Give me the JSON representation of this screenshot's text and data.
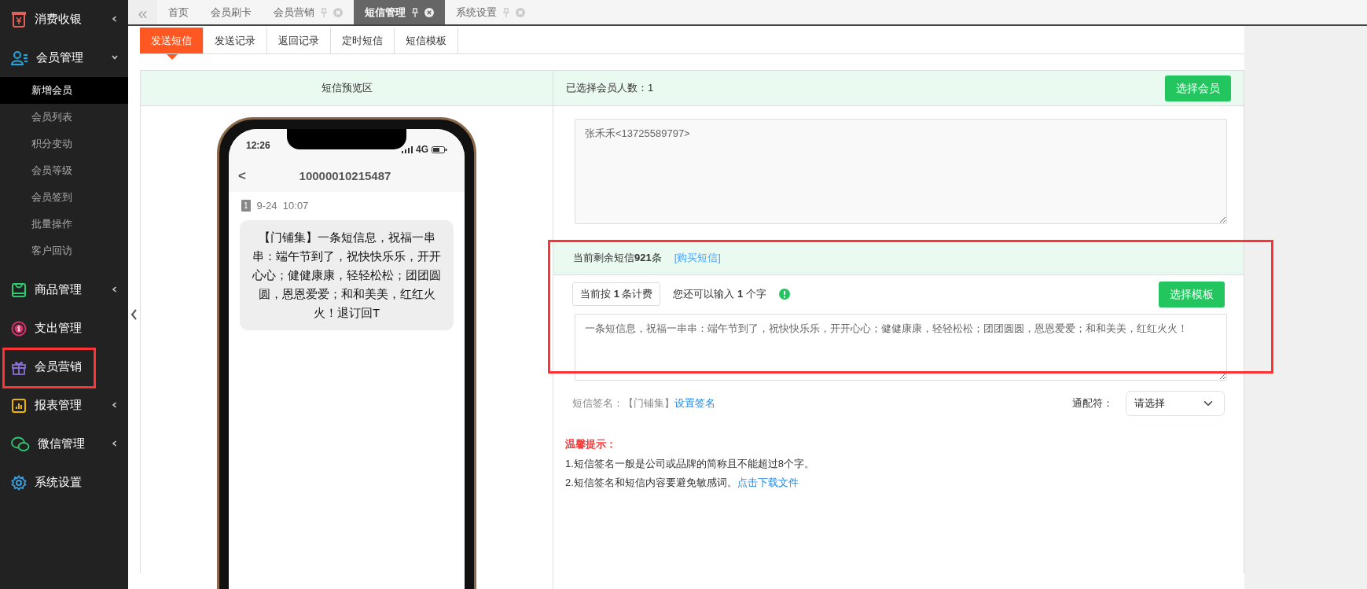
{
  "sidebar": {
    "items": [
      {
        "label": "消费收银",
        "expanded": false,
        "highlighted": false
      },
      {
        "label": "会员管理",
        "expanded": true,
        "highlighted": false,
        "children": [
          {
            "label": "新增会员",
            "selected": true
          },
          {
            "label": "会员列表",
            "selected": false
          },
          {
            "label": "积分变动",
            "selected": false
          },
          {
            "label": "会员等级",
            "selected": false
          },
          {
            "label": "会员签到",
            "selected": false
          },
          {
            "label": "批量操作",
            "selected": false
          },
          {
            "label": "客户回访",
            "selected": false
          }
        ]
      },
      {
        "label": "商品管理",
        "expanded": false,
        "highlighted": false
      },
      {
        "label": "支出管理",
        "highlighted": false
      },
      {
        "label": "会员营销",
        "highlighted": true
      },
      {
        "label": "报表管理",
        "expanded": false,
        "highlighted": false
      },
      {
        "label": "微信管理",
        "expanded": false,
        "highlighted": false
      },
      {
        "label": "系统设置",
        "highlighted": false
      }
    ]
  },
  "top_tabs": {
    "collapse_button": "«",
    "tabs": [
      {
        "label": "首页",
        "closable": false,
        "selected": false
      },
      {
        "label": "会员刷卡",
        "closable": false,
        "selected": false
      },
      {
        "label": "会员营销",
        "closable": true,
        "selected": false
      },
      {
        "label": "短信管理",
        "closable": true,
        "selected": true
      },
      {
        "label": "系统设置",
        "closable": true,
        "selected": false
      }
    ]
  },
  "sub_tabs": [
    {
      "label": "发送短信",
      "selected": true
    },
    {
      "label": "发送记录",
      "selected": false
    },
    {
      "label": "返回记录",
      "selected": false
    },
    {
      "label": "定时短信",
      "selected": false
    },
    {
      "label": "短信模板",
      "selected": false
    }
  ],
  "preview": {
    "title": "短信预览区",
    "phone": {
      "time": "12:26",
      "network": "4G",
      "back": "<",
      "sender": "10000010215487",
      "sim": "1",
      "date": "9-24  10:07",
      "message": "【门铺集】一条短信息，祝福一串串：端午节到了，祝快快乐乐，开开心心；健健康康，轻轻松松；团团圆圆，恩恩爱爱；和和美美，红红火火！退订回T"
    }
  },
  "recipients": {
    "label": "已选择会员人数：1",
    "button": "选择会员",
    "value": "张禾禾<13725589797>"
  },
  "sms": {
    "highlighted": true,
    "balance": "当前剩余短信**921**条",
    "buy_link": "[购买短信]",
    "billing": "当前按 **1** 条计费",
    "remaining": "您还可以输入 **1** 个字",
    "template_button": "选择模板",
    "message": "一条短信息，祝福一串串：端午节到了，祝快快乐乐，开开心心；健健康康，轻轻松松；团团圆圆，恩恩爱爱；和和美美，红红火火！",
    "signature_label": "短信签名：【门铺集】",
    "signature_link": "设置签名",
    "wildcard_label": "通配符：",
    "wildcard_select": "请选择"
  },
  "tips": {
    "title": "温馨提示：",
    "lines": [
      {
        "text": "1.短信签名一般是公司或品牌的简称且不能超过8个字。"
      },
      {
        "text": "2.短信签名和短信内容要避免敏感词。",
        "link": "点击下载文件"
      }
    ]
  }
}
